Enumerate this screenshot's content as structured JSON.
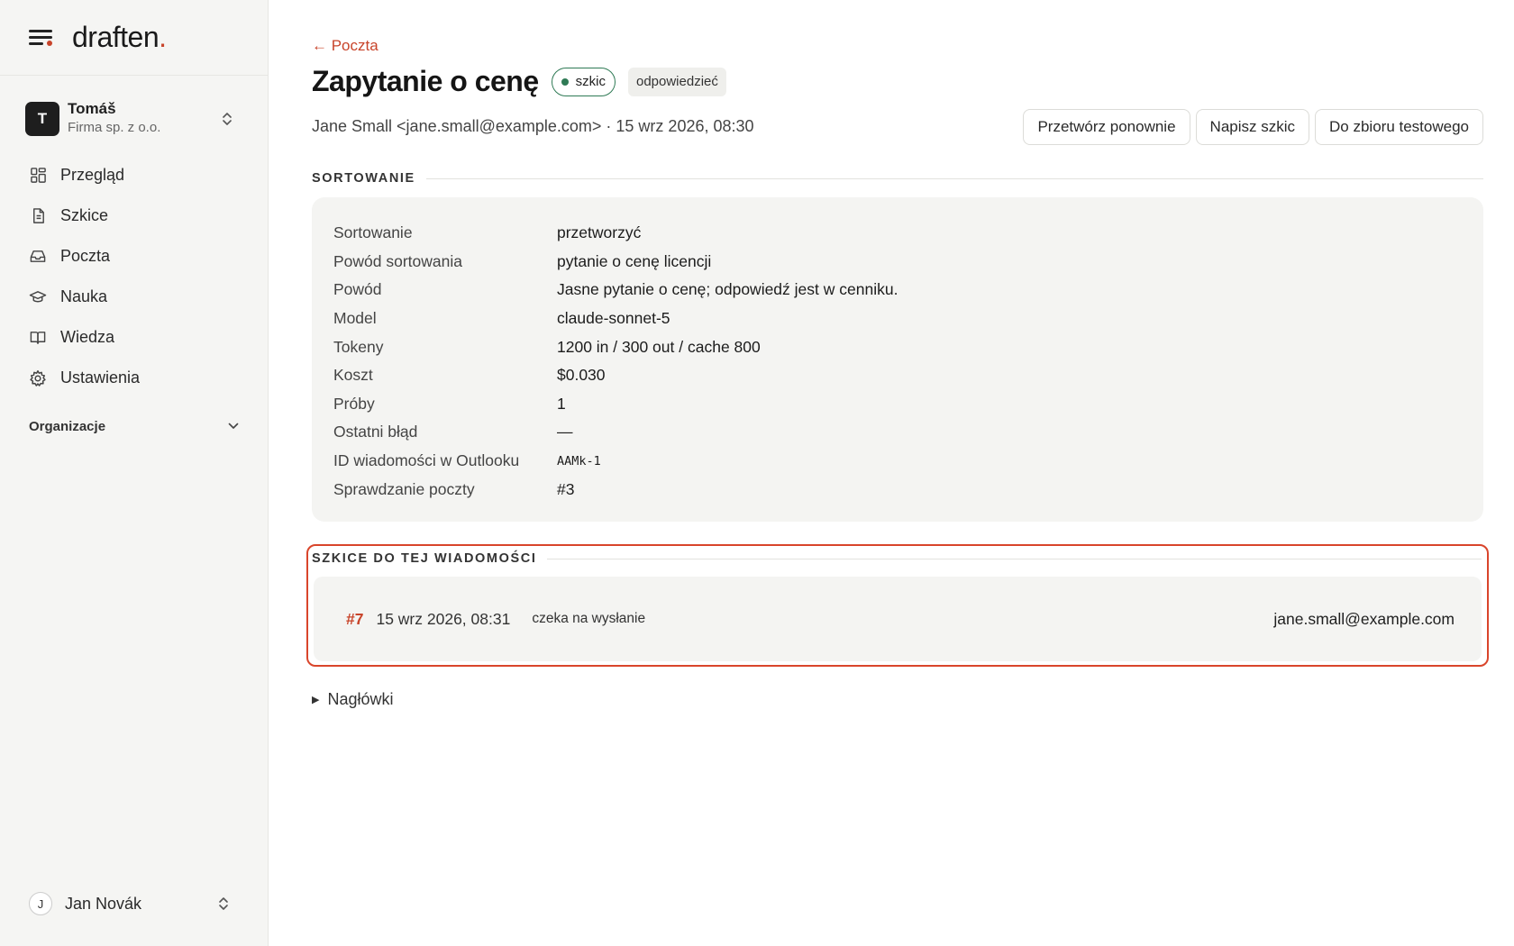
{
  "brand": {
    "name": "draften",
    "dot": "."
  },
  "org": {
    "initial": "T",
    "name": "Tomáš",
    "company": "Firma sp. z o.o."
  },
  "nav": {
    "items": [
      {
        "label": "Przegląd",
        "icon": "dashboard-icon"
      },
      {
        "label": "Szkice",
        "icon": "document-icon"
      },
      {
        "label": "Poczta",
        "icon": "inbox-icon"
      },
      {
        "label": "Nauka",
        "icon": "graduation-cap-icon"
      },
      {
        "label": "Wiedza",
        "icon": "book-icon"
      },
      {
        "label": "Ustawienia",
        "icon": "gear-icon"
      }
    ],
    "section_label": "Organizacje"
  },
  "user": {
    "initial": "J",
    "name": "Jan Novák"
  },
  "header": {
    "back_label": "← Poczta",
    "title": "Zapytanie o cenę",
    "status_badge": "szkic",
    "tag_badge": "odpowiedzieć",
    "meta": "Jane Small <jane.small@example.com> · 15 wrz 2026, 08:30",
    "actions": {
      "reprocess": "Przetwórz ponownie",
      "write_draft": "Napisz szkic",
      "to_test_set": "Do zbioru testowego"
    }
  },
  "sorting": {
    "section_title": "SORTOWANIE",
    "rows": [
      {
        "key": "Sortowanie",
        "value": "przetworzyć"
      },
      {
        "key": "Powód sortowania",
        "value": "pytanie o cenę licencji"
      },
      {
        "key": "Powód",
        "value": "Jasne pytanie o cenę; odpowiedź jest w cenniku."
      },
      {
        "key": "Model",
        "value": "claude-sonnet-5"
      },
      {
        "key": "Tokeny",
        "value": "1200 in / 300 out / cache 800"
      },
      {
        "key": "Koszt",
        "value": "$0.030"
      },
      {
        "key": "Próby",
        "value": "1"
      },
      {
        "key": "Ostatni błąd",
        "value": "—"
      },
      {
        "key": "ID wiadomości w Outlooku",
        "value": "AAMk-1"
      },
      {
        "key": "Sprawdzanie poczty",
        "value": "#3"
      }
    ]
  },
  "drafts": {
    "section_title": "SZKICE DO TEJ WIADOMOŚCI",
    "items": [
      {
        "id": "#7",
        "date": "15 wrz 2026, 08:31",
        "status": "czeka na wysłanie",
        "to": "jane.small@example.com"
      }
    ]
  },
  "headers": {
    "label": "Nagłówki",
    "arrow": "▶"
  },
  "colors": {
    "accent": "#c8442a",
    "status_green": "#2f7a55",
    "highlight": "#d9452b"
  }
}
